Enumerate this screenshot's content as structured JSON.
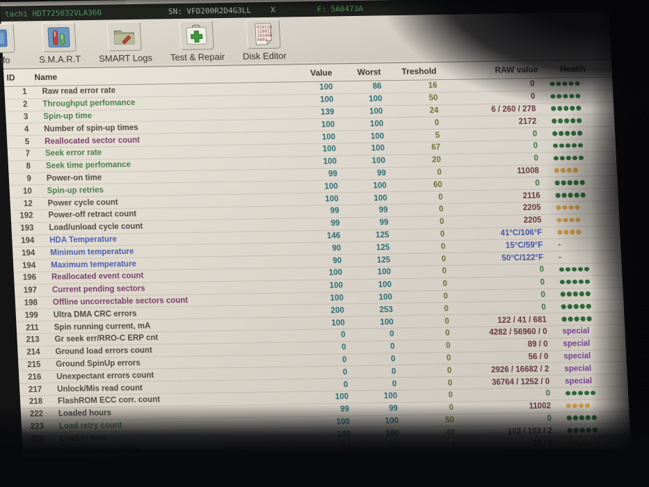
{
  "device_bar": {
    "model": "tachi HDT725032VLA360",
    "serial": "SN: VFD200R2D4G3LL",
    "close": "X",
    "firmware": "F: 5A0473A"
  },
  "toolbar": {
    "buttons": [
      {
        "label": "e Info",
        "icon": "drive-info-icon"
      },
      {
        "label": "S.M.A.R.T",
        "icon": "smart-icon"
      },
      {
        "label": "SMART Logs",
        "icon": "smart-logs-icon"
      },
      {
        "label": "Test & Repair",
        "icon": "test-repair-icon"
      },
      {
        "label": "Disk Editor",
        "icon": "disk-editor-icon"
      }
    ],
    "binary_lines": [
      "010110",
      "110011",
      "101000",
      "0001"
    ]
  },
  "colors": {
    "name": {
      "green": "#3a7d44",
      "dark": "#46413a",
      "purple": "#77356b",
      "blue": "#3d56bb"
    },
    "raw": {
      "maroon": "#6b3340",
      "green": "#357d3d",
      "blue": "#3d56bb"
    },
    "health": {
      "green": "#256e38",
      "orange": "#dfa33c"
    }
  },
  "table": {
    "headers": {
      "id": "ID",
      "name": "Name",
      "value": "Value",
      "worst": "Worst",
      "treshold": "Treshold",
      "raw": "RAW value",
      "health": "Health"
    },
    "rows": [
      {
        "id": "1",
        "name": "Raw read error rate",
        "name_color": "dark",
        "value": "100",
        "worst": "86",
        "treshold": "16",
        "raw": "0",
        "raw_color": "maroon",
        "health": {
          "type": "dots",
          "count": 5,
          "color": "green"
        }
      },
      {
        "id": "2",
        "name": "Throughput perfomance",
        "name_color": "green",
        "value": "100",
        "worst": "100",
        "treshold": "50",
        "raw": "0",
        "raw_color": "maroon",
        "health": {
          "type": "dots",
          "count": 5,
          "color": "green"
        }
      },
      {
        "id": "3",
        "name": "Spin-up time",
        "name_color": "green",
        "value": "139",
        "worst": "100",
        "treshold": "24",
        "raw": "6 / 260 / 278",
        "raw_color": "maroon",
        "health": {
          "type": "dots",
          "count": 5,
          "color": "green"
        }
      },
      {
        "id": "4",
        "name": "Number of spin-up times",
        "name_color": "dark",
        "value": "100",
        "worst": "100",
        "treshold": "0",
        "raw": "2172",
        "raw_color": "maroon",
        "health": {
          "type": "dots",
          "count": 5,
          "color": "green"
        }
      },
      {
        "id": "5",
        "name": "Reallocated sector count",
        "name_color": "purple",
        "value": "100",
        "worst": "100",
        "treshold": "5",
        "raw": "0",
        "raw_color": "green",
        "health": {
          "type": "dots",
          "count": 5,
          "color": "green"
        }
      },
      {
        "id": "7",
        "name": "Seek error rate",
        "name_color": "green",
        "value": "100",
        "worst": "100",
        "treshold": "67",
        "raw": "0",
        "raw_color": "green",
        "health": {
          "type": "dots",
          "count": 5,
          "color": "green"
        }
      },
      {
        "id": "8",
        "name": "Seek time perfomance",
        "name_color": "green",
        "value": "100",
        "worst": "100",
        "treshold": "20",
        "raw": "0",
        "raw_color": "green",
        "health": {
          "type": "dots",
          "count": 5,
          "color": "green"
        }
      },
      {
        "id": "9",
        "name": "Power-on time",
        "name_color": "dark",
        "value": "99",
        "worst": "99",
        "treshold": "0",
        "raw": "11008",
        "raw_color": "maroon",
        "health": {
          "type": "dots",
          "count": 4,
          "color": "orange"
        }
      },
      {
        "id": "10",
        "name": "Spin-up retries",
        "name_color": "green",
        "value": "100",
        "worst": "100",
        "treshold": "60",
        "raw": "0",
        "raw_color": "green",
        "health": {
          "type": "dots",
          "count": 5,
          "color": "green"
        }
      },
      {
        "id": "12",
        "name": "Power cycle count",
        "name_color": "dark",
        "value": "100",
        "worst": "100",
        "treshold": "0",
        "raw": "2116",
        "raw_color": "maroon",
        "health": {
          "type": "dots",
          "count": 5,
          "color": "green"
        }
      },
      {
        "id": "192",
        "name": "Power-off retract count",
        "name_color": "dark",
        "value": "99",
        "worst": "99",
        "treshold": "0",
        "raw": "2205",
        "raw_color": "maroon",
        "health": {
          "type": "dots",
          "count": 4,
          "color": "orange"
        }
      },
      {
        "id": "193",
        "name": "Load/unload cycle count",
        "name_color": "dark",
        "value": "99",
        "worst": "99",
        "treshold": "0",
        "raw": "2205",
        "raw_color": "maroon",
        "health": {
          "type": "dots",
          "count": 4,
          "color": "orange"
        }
      },
      {
        "id": "194",
        "name": "HDA Temperature",
        "name_color": "blue",
        "value": "146",
        "worst": "125",
        "treshold": "0",
        "raw": "41°C/106°F",
        "raw_color": "blue",
        "health": {
          "type": "dots",
          "count": 4,
          "color": "orange"
        }
      },
      {
        "id": "194",
        "name": "Minimum temperature",
        "name_color": "blue",
        "value": "90",
        "worst": "125",
        "treshold": "0",
        "raw": "15°C/59°F",
        "raw_color": "blue",
        "health": {
          "type": "text",
          "text": "-"
        }
      },
      {
        "id": "194",
        "name": "Maximum temperature",
        "name_color": "blue",
        "value": "90",
        "worst": "125",
        "treshold": "0",
        "raw": "50°C/122°F",
        "raw_color": "blue",
        "health": {
          "type": "text",
          "text": "-"
        }
      },
      {
        "id": "196",
        "name": "Reallocated event count",
        "name_color": "purple",
        "value": "100",
        "worst": "100",
        "treshold": "0",
        "raw": "0",
        "raw_color": "green",
        "health": {
          "type": "dots",
          "count": 5,
          "color": "green"
        }
      },
      {
        "id": "197",
        "name": "Current pending sectors",
        "name_color": "purple",
        "value": "100",
        "worst": "100",
        "treshold": "0",
        "raw": "0",
        "raw_color": "green",
        "health": {
          "type": "dots",
          "count": 5,
          "color": "green"
        }
      },
      {
        "id": "198",
        "name": "Offline uncorrectable sectors count",
        "name_color": "purple",
        "value": "100",
        "worst": "100",
        "treshold": "0",
        "raw": "0",
        "raw_color": "green",
        "health": {
          "type": "dots",
          "count": 5,
          "color": "green"
        }
      },
      {
        "id": "199",
        "name": "Ultra DMA CRC errors",
        "name_color": "dark",
        "value": "200",
        "worst": "253",
        "treshold": "0",
        "raw": "0",
        "raw_color": "green",
        "health": {
          "type": "dots",
          "count": 5,
          "color": "green"
        }
      },
      {
        "id": "211",
        "name": "Spin running current, mA",
        "name_color": "dark",
        "value": "100",
        "worst": "100",
        "treshold": "0",
        "raw": "122 / 41 / 681",
        "raw_color": "maroon",
        "health": {
          "type": "dots",
          "count": 5,
          "color": "green"
        }
      },
      {
        "id": "213",
        "name": "Gr seek err/RRO-C ERP cnt",
        "name_color": "dark",
        "value": "0",
        "worst": "0",
        "treshold": "0",
        "raw": "4282 / 56960 / 0",
        "raw_color": "maroon",
        "health": {
          "type": "text",
          "text": "special"
        }
      },
      {
        "id": "214",
        "name": "Ground load errors count",
        "name_color": "dark",
        "value": "0",
        "worst": "0",
        "treshold": "0",
        "raw": "89 / 0",
        "raw_color": "maroon",
        "health": {
          "type": "text",
          "text": "special"
        }
      },
      {
        "id": "215",
        "name": "Ground SpinUp errors",
        "name_color": "dark",
        "value": "0",
        "worst": "0",
        "treshold": "0",
        "raw": "56 / 0",
        "raw_color": "maroon",
        "health": {
          "type": "text",
          "text": "special"
        }
      },
      {
        "id": "216",
        "name": "Unexpectant errors count",
        "name_color": "dark",
        "value": "0",
        "worst": "0",
        "treshold": "0",
        "raw": "2926 / 16682 / 2",
        "raw_color": "maroon",
        "health": {
          "type": "text",
          "text": "special"
        }
      },
      {
        "id": "217",
        "name": "Unlock/Mis read count",
        "name_color": "dark",
        "value": "0",
        "worst": "0",
        "treshold": "0",
        "raw": "36764 / 1252 / 0",
        "raw_color": "maroon",
        "health": {
          "type": "text",
          "text": "special"
        }
      },
      {
        "id": "218",
        "name": "FlashROM ECC corr. count",
        "name_color": "dark",
        "value": "100",
        "worst": "100",
        "treshold": "0",
        "raw": "0",
        "raw_color": "green",
        "health": {
          "type": "dots",
          "count": 5,
          "color": "green"
        }
      },
      {
        "id": "222",
        "name": "Loaded hours",
        "name_color": "dark",
        "value": "99",
        "worst": "99",
        "treshold": "0",
        "raw": "11002",
        "raw_color": "maroon",
        "health": {
          "type": "dots",
          "count": 4,
          "color": "orange"
        }
      },
      {
        "id": "223",
        "name": "Load retry count",
        "name_color": "green",
        "value": "100",
        "worst": "100",
        "treshold": "50",
        "raw": "0",
        "raw_color": "green",
        "health": {
          "type": "dots",
          "count": 5,
          "color": "green"
        }
      },
      {
        "id": "226",
        "name": "Load-in time",
        "name_color": "green",
        "value": "149",
        "worst": "100",
        "treshold": "40",
        "raw": "103 / 103 / 2",
        "raw_color": "maroon",
        "health": {
          "type": "dots",
          "count": 5,
          "color": "green"
        }
      },
      {
        "id": "230",
        "name": "GMR head amplitude",
        "name_color": "dark",
        "value": "92",
        "worst": "83",
        "treshold": "0",
        "raw": "22 / 0",
        "raw_color": "maroon",
        "health": {
          "type": "dots",
          "count": 4,
          "color": "orange"
        }
      }
    ]
  }
}
